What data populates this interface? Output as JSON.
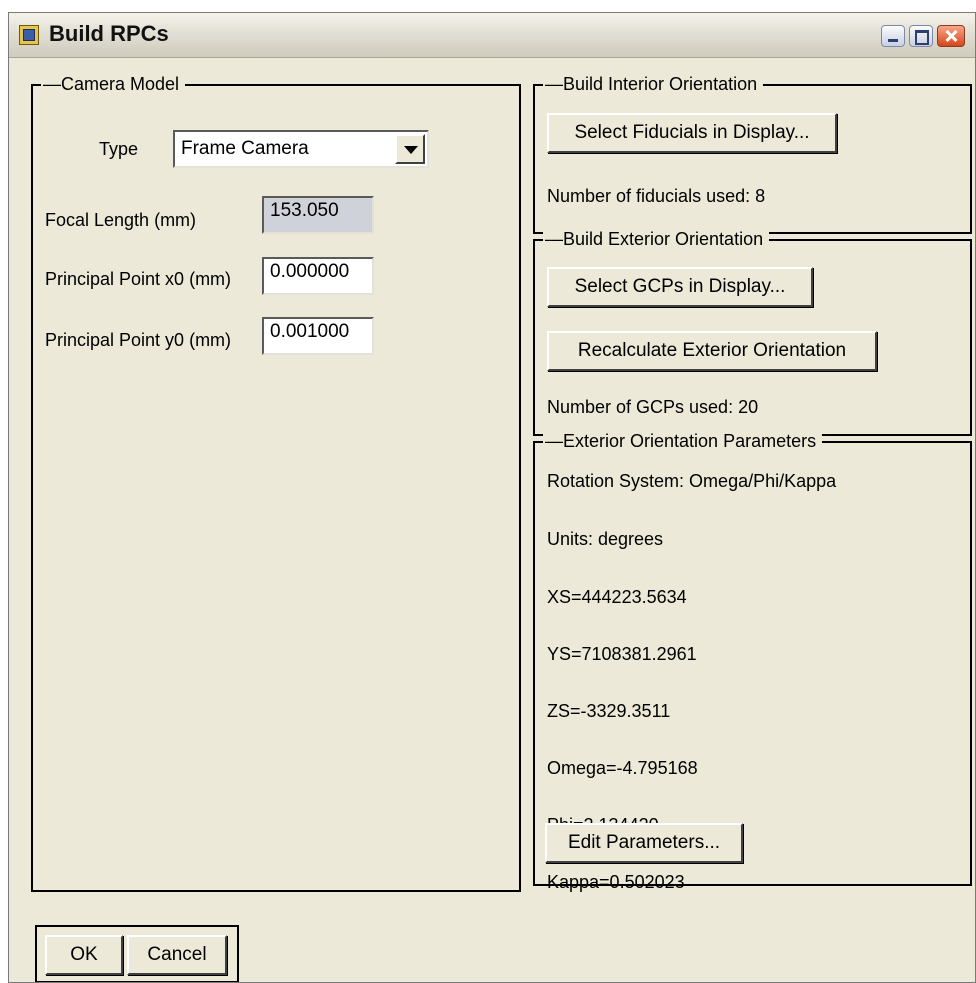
{
  "window": {
    "title": "Build RPCs",
    "icon": "app-icon"
  },
  "camera_model": {
    "legend": "Camera Model",
    "type_label": "Type",
    "type_value": "Frame Camera",
    "focal_length_label": "Focal Length (mm)",
    "focal_length_value": "153.050",
    "ppx_label": "Principal Point x0 (mm)",
    "ppx_value": "0.000000",
    "ppy_label": "Principal Point y0 (mm)",
    "ppy_value": "0.001000"
  },
  "interior": {
    "legend": "Build Interior Orientation",
    "select_button": "Select Fiducials in Display...",
    "count_text": "Number of fiducials used: 8"
  },
  "exterior": {
    "legend": "Build Exterior Orientation",
    "select_button": "Select GCPs in Display...",
    "recalc_button": "Recalculate Exterior Orientation",
    "count_text": "Number of GCPs used: 20"
  },
  "parameters": {
    "legend": "Exterior Orientation Parameters",
    "rotation": "Rotation System: Omega/Phi/Kappa",
    "units": "Units: degrees",
    "xs": "XS=444223.5634",
    "ys": "YS=7108381.2961",
    "zs": "ZS=-3329.3511",
    "omega": "Omega=-4.795168",
    "phi": "Phi=2.134420",
    "kappa": "Kappa=0.502023",
    "edit_button": "Edit Parameters..."
  },
  "footer": {
    "ok": "OK",
    "cancel": "Cancel"
  }
}
